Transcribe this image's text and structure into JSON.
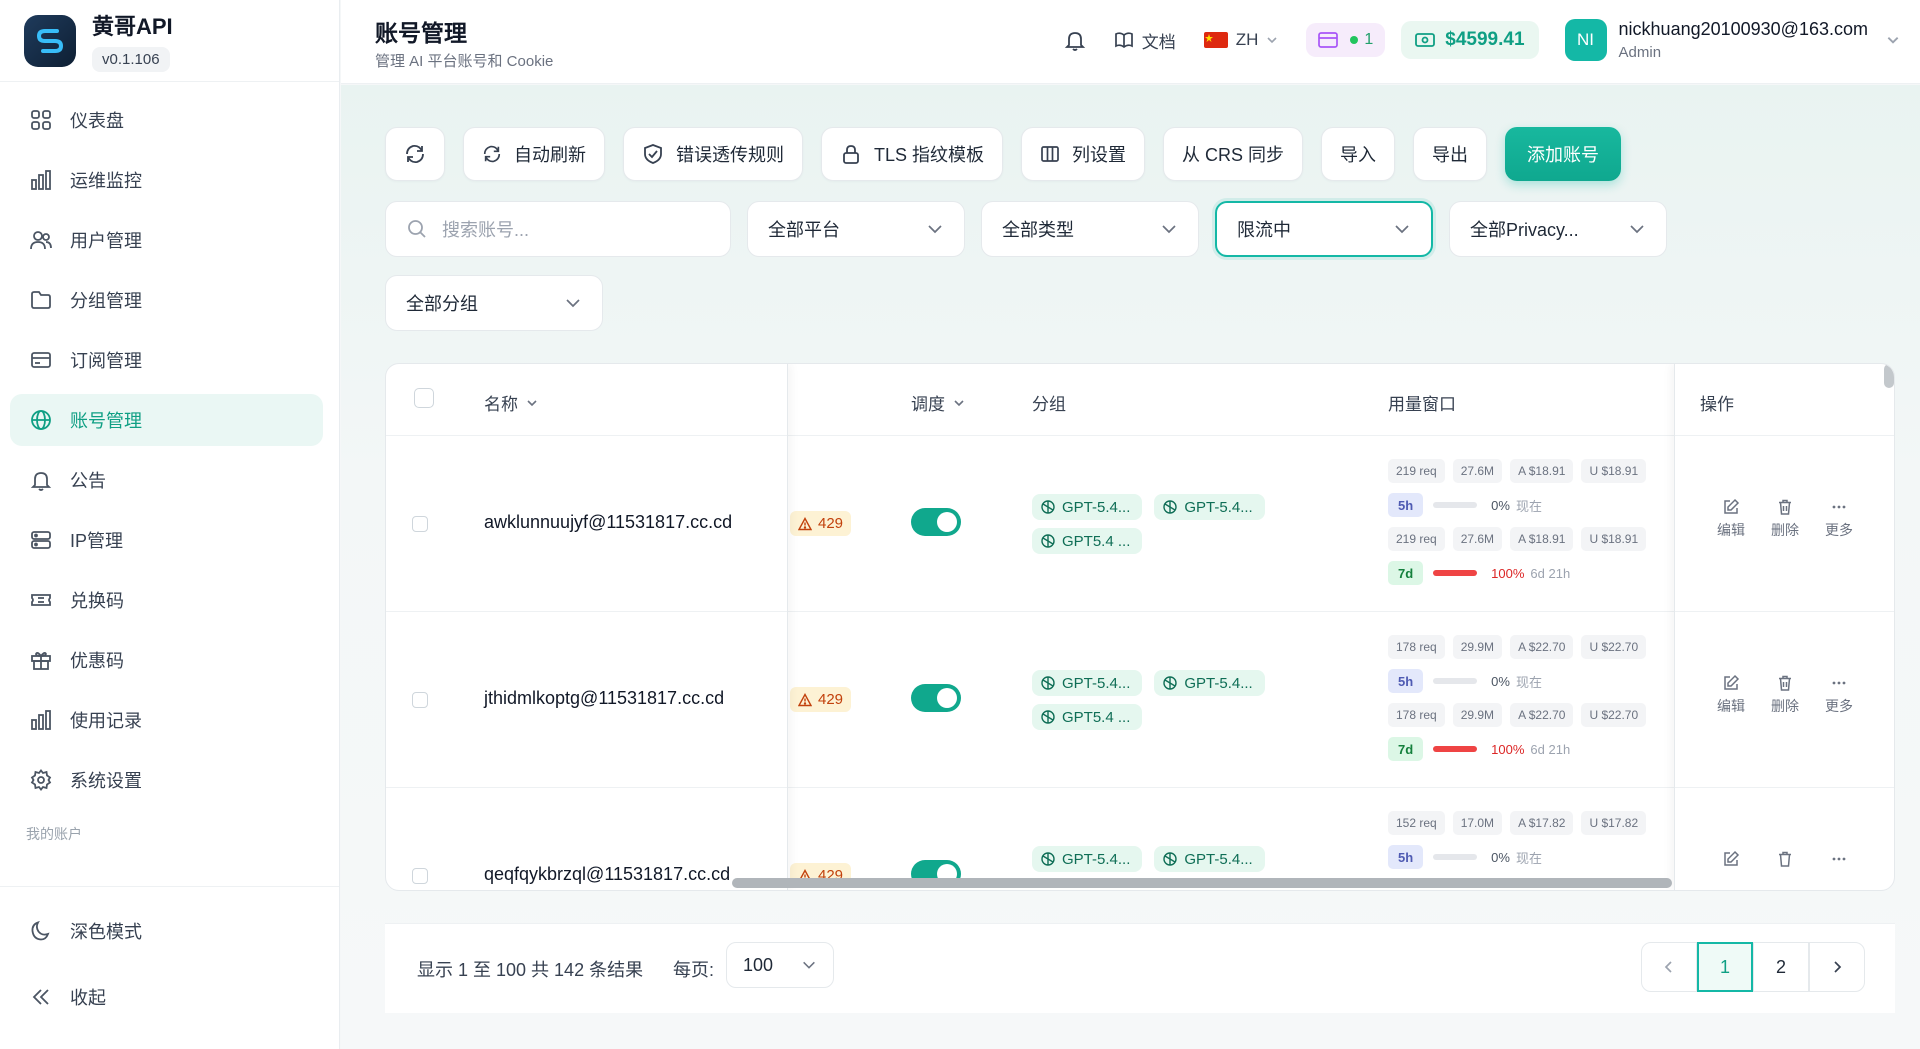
{
  "brand": {
    "name": "黄哥API",
    "version": "v0.1.106"
  },
  "sidebar": {
    "items": [
      {
        "label": "仪表盘",
        "icon": "dashboard-icon"
      },
      {
        "label": "运维监控",
        "icon": "bar-chart-icon"
      },
      {
        "label": "用户管理",
        "icon": "users-icon"
      },
      {
        "label": "分组管理",
        "icon": "folder-icon"
      },
      {
        "label": "订阅管理",
        "icon": "credit-card-icon"
      },
      {
        "label": "账号管理",
        "icon": "globe-icon",
        "active": true
      },
      {
        "label": "公告",
        "icon": "bell-icon"
      },
      {
        "label": "IP管理",
        "icon": "server-icon"
      },
      {
        "label": "兑换码",
        "icon": "ticket-icon"
      },
      {
        "label": "优惠码",
        "icon": "gift-icon"
      },
      {
        "label": "使用记录",
        "icon": "bar-chart-icon"
      },
      {
        "label": "系统设置",
        "icon": "gear-icon"
      }
    ],
    "section_label": "我的账户",
    "bottom": [
      {
        "label": "深色模式",
        "icon": "moon-icon"
      },
      {
        "label": "收起",
        "icon": "collapse-icon"
      }
    ]
  },
  "header": {
    "title": "账号管理",
    "subtitle": "管理 AI 平台账号和 Cookie",
    "docs_label": "文档",
    "lang_label": "ZH",
    "subscription_count": "1",
    "balance": "$4599.41",
    "user": {
      "initials": "NI",
      "email": "nickhuang20100930@163.com",
      "role": "Admin"
    }
  },
  "toolbar": {
    "auto_refresh": "自动刷新",
    "error_rules": "错误透传规则",
    "tls_template": "TLS 指纹模板",
    "column_settings": "列设置",
    "sync_crs": "从 CRS 同步",
    "import": "导入",
    "export": "导出",
    "add_account": "添加账号"
  },
  "filters": {
    "search_placeholder": "搜索账号...",
    "platform": "全部平台",
    "type": "全部类型",
    "status": "限流中",
    "privacy": "全部Privacy...",
    "group": "全部分组"
  },
  "table": {
    "columns": {
      "name": "名称",
      "schedule": "调度",
      "group": "分组",
      "usage": "用量窗口",
      "actions": "操作"
    },
    "ops": {
      "edit": "编辑",
      "delete": "删除",
      "more": "更多"
    },
    "rows": [
      {
        "email": "awklunnuujyf@11531817.cc.cd",
        "status": "429",
        "groups": [
          "GPT-5.4...",
          "GPT-5.4...",
          "GPT5.4 ..."
        ],
        "w5h_stats": [
          "219 req",
          "27.6M",
          "A $18.91",
          "U $18.91"
        ],
        "w5h": {
          "label": "5h",
          "pct": "0%",
          "reset": "现在",
          "fill": 0
        },
        "w7d_stats": [
          "219 req",
          "27.6M",
          "A $18.91",
          "U $18.91"
        ],
        "w7d": {
          "label": "7d",
          "pct": "100%",
          "reset": "6d 21h",
          "fill": 100
        }
      },
      {
        "email": "jthidmlkoptg@11531817.cc.cd",
        "status": "429",
        "groups": [
          "GPT-5.4...",
          "GPT-5.4...",
          "GPT5.4 ..."
        ],
        "w5h_stats": [
          "178 req",
          "29.9M",
          "A $22.70",
          "U $22.70"
        ],
        "w5h": {
          "label": "5h",
          "pct": "0%",
          "reset": "现在",
          "fill": 0
        },
        "w7d_stats": [
          "178 req",
          "29.9M",
          "A $22.70",
          "U $22.70"
        ],
        "w7d": {
          "label": "7d",
          "pct": "100%",
          "reset": "6d 21h",
          "fill": 100
        }
      },
      {
        "email": "qeqfqykbrzql@11531817.cc.cd",
        "status": "429",
        "groups": [
          "GPT-5.4...",
          "GPT-5.4..."
        ],
        "w5h_stats": [
          "152 req",
          "17.0M",
          "A $17.82",
          "U $17.82"
        ],
        "w5h": {
          "label": "5h",
          "pct": "0%",
          "reset": "现在",
          "fill": 0
        }
      }
    ]
  },
  "pagination": {
    "summary": "显示 1 至 100 共 142 条结果",
    "per_page_label": "每页:",
    "per_page": "100",
    "pages": [
      "1",
      "2"
    ],
    "current": "1"
  },
  "colors": {
    "accent": "#14b8a6",
    "accent_dark": "#0f9f84",
    "danger": "#ef4444",
    "warning_bg": "#fdf2d4"
  }
}
